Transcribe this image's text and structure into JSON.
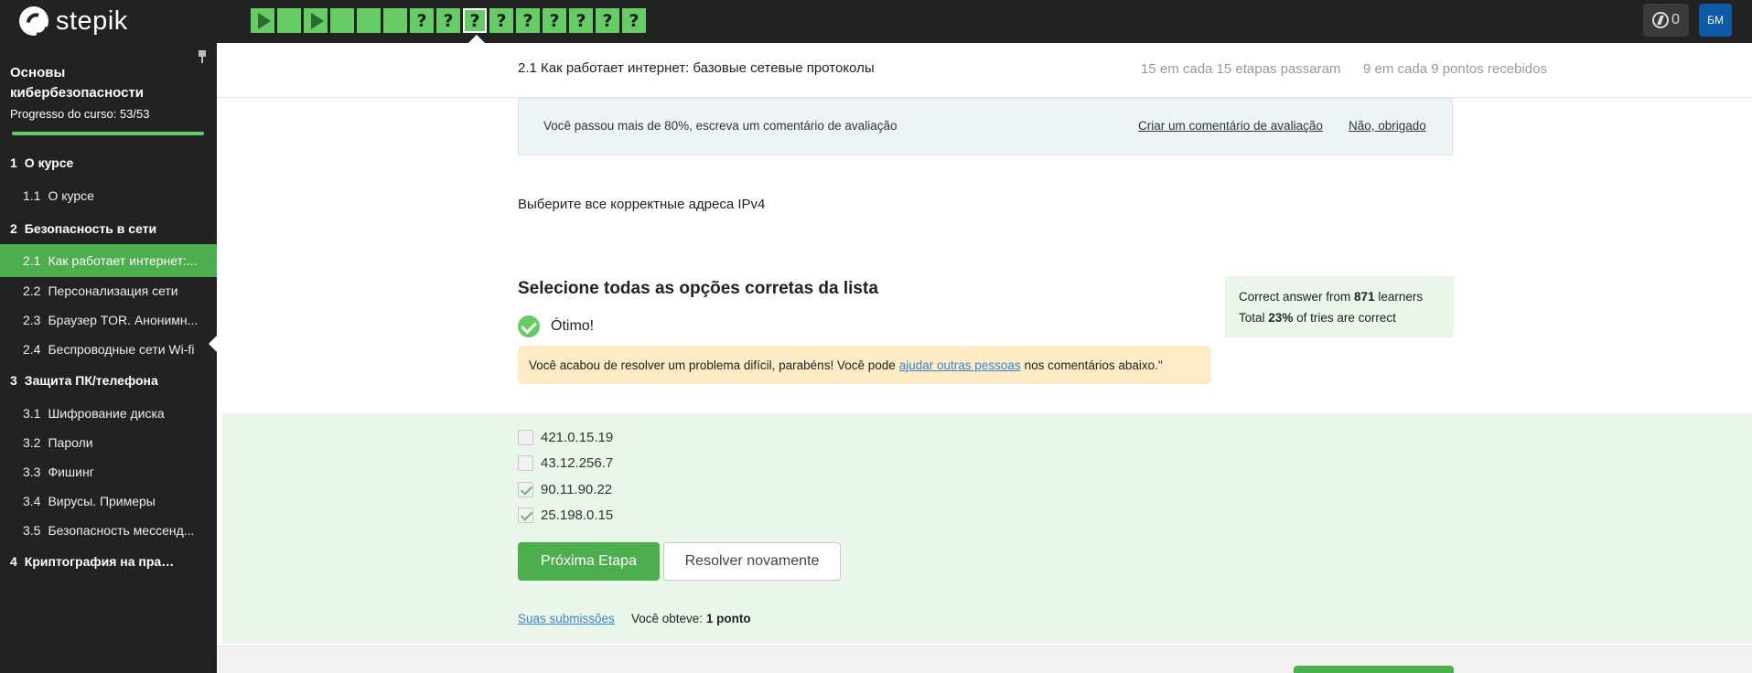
{
  "app": {
    "logo_text": "stepik"
  },
  "steps": [
    {
      "type": "play"
    },
    {
      "type": "done"
    },
    {
      "type": "play"
    },
    {
      "type": "done"
    },
    {
      "type": "done"
    },
    {
      "type": "done"
    },
    {
      "type": "quiz",
      "label": "?"
    },
    {
      "type": "quiz",
      "label": "?"
    },
    {
      "type": "quiz",
      "label": "?",
      "current": true
    },
    {
      "type": "quiz",
      "label": "?"
    },
    {
      "type": "quiz",
      "label": "?"
    },
    {
      "type": "quiz",
      "label": "?"
    },
    {
      "type": "quiz",
      "label": "?"
    },
    {
      "type": "quiz",
      "label": "?"
    },
    {
      "type": "quiz",
      "label": "?"
    }
  ],
  "header": {
    "energy_count": "0",
    "avatar_initials": "БМ"
  },
  "sidebar": {
    "course_title": "Основы кибербезопасности",
    "progress_text": "Progresso do curso:  53/53",
    "progress_fraction": 1.0,
    "items": [
      {
        "kind": "section",
        "num": "1",
        "label": "О курсе"
      },
      {
        "kind": "lesson",
        "num": "1.1",
        "label": "О курсе"
      },
      {
        "kind": "section",
        "num": "2",
        "label": "Безопасность в сети"
      },
      {
        "kind": "lesson",
        "num": "2.1",
        "label": "Как работает интернет:...",
        "active": true
      },
      {
        "kind": "lesson",
        "num": "2.2",
        "label": "Персонализация сети"
      },
      {
        "kind": "lesson",
        "num": "2.3",
        "label": "Браузер TOR. Анонимн..."
      },
      {
        "kind": "lesson",
        "num": "2.4",
        "label": "Беспроводные сети Wi-fi"
      },
      {
        "kind": "section",
        "num": "3",
        "label": "Защита ПК/телефона"
      },
      {
        "kind": "lesson",
        "num": "3.1",
        "label": "Шифрование диска"
      },
      {
        "kind": "lesson",
        "num": "3.2",
        "label": "Пароли"
      },
      {
        "kind": "lesson",
        "num": "3.3",
        "label": "Фишинг"
      },
      {
        "kind": "lesson",
        "num": "3.4",
        "label": "Вирусы. Примеры"
      },
      {
        "kind": "lesson",
        "num": "3.5",
        "label": "Безопасность мессенд..."
      },
      {
        "kind": "section",
        "num": "4",
        "label": "Криптография на практи..."
      }
    ]
  },
  "lesson": {
    "title": "2.1 Как работает интернет: базовые сетевые протоколы",
    "steps_passed": "15 em cada 15 etapas passaram",
    "points": "9 em cada 9 pontos  recebidos"
  },
  "review": {
    "text": "Você passou mais de 80%, escreva um comentário de avaliação",
    "create_link": "Criar um comentário de avaliação",
    "decline_link": "Não, obrigado"
  },
  "question": "Выберите все корректные адреса IPv4",
  "quiz": {
    "title": "Selecione todas as opções corretas da lista",
    "ok_text": "Ótimo!",
    "hint_before": "Você acabou de resolver um problema difícil, parabéns! Você pode",
    "hint_link": "ajudar outras pessoas",
    "hint_after": "nos comentários abaixo.\"",
    "options": [
      {
        "label": "421.0.15.19",
        "checked": false
      },
      {
        "label": "43.12.256.7",
        "checked": false
      },
      {
        "label": "90.11.90.22",
        "checked": true
      },
      {
        "label": "25.198.0.15",
        "checked": true
      }
    ],
    "next_button": "Próxima Etapa",
    "retry_button": "Resolver novamente",
    "submissions_link": "Suas submissões",
    "score_prefix": "Você obteve:",
    "score_value": "1 ponto"
  },
  "stats": {
    "line1_prefix": "Correct answer from",
    "line1_value": "871",
    "line1_suffix": "learners",
    "line2_prefix": "Total",
    "line2_value": "23%",
    "line2_suffix": "of tries are correct"
  },
  "colors": {
    "accent": "#66cc66",
    "brand_dark": "#222222",
    "link": "#3f82d0",
    "avatar": "#0d5aa6"
  }
}
